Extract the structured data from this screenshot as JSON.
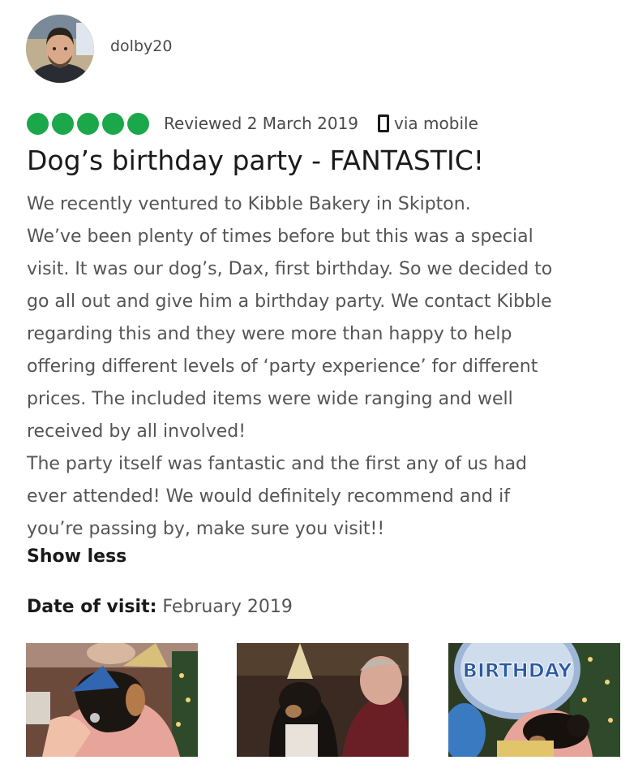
{
  "reviewer": {
    "username": "dolby20"
  },
  "review": {
    "rating": 5,
    "rating_max": 5,
    "reviewed_date": "Reviewed 2 March 2019",
    "device_icon": "mobile-phone-icon",
    "via": "via mobile",
    "title": "Dog’s birthday party - FANTASTIC!",
    "body_lines": [
      "We recently ventured to Kibble Bakery in Skipton.",
      "We’ve been plenty of times before but this was a special",
      "visit. It was our dog’s, Dax, first birthday. So we decided to",
      "go all out and give him a birthday party. We contact Kibble",
      "regarding this and they were more than happy to help",
      "offering different levels of ‘party experience’ for different",
      "prices. The included items were wide ranging and well",
      "received by all involved!",
      "The party itself was fantastic and the first any of us had",
      "ever attended! We would definitely recommend and if",
      "you’re passing by, make sure you visit!!"
    ],
    "show_less": "Show less",
    "date_of_visit_label": "Date of visit:",
    "date_of_visit_value": "February 2019"
  },
  "photos": [
    {
      "name": "photo-dog-held-party-hat"
    },
    {
      "name": "photo-dog-party-hat-with-man"
    },
    {
      "name": "photo-dog-birthday-balloon",
      "balloon_text": "BIRTHDAY"
    }
  ],
  "colors": {
    "rating_bubble": "#1aa84a",
    "text_primary": "#1a1a1a",
    "text_secondary": "#555555"
  }
}
